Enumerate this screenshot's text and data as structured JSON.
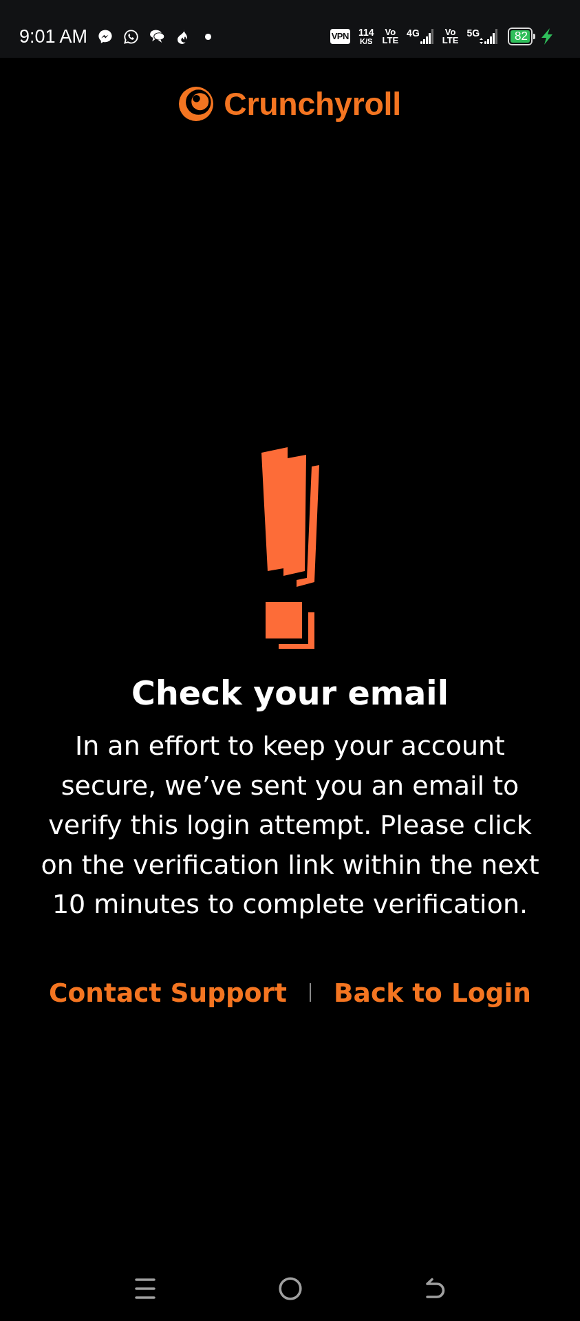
{
  "status_bar": {
    "time": "9:01 AM",
    "indicators": [
      {
        "kind": "vpn",
        "label": "VPN"
      },
      {
        "kind": "speed",
        "value": "114",
        "unit": "K/S"
      },
      {
        "kind": "volte",
        "top": "Vo",
        "bottom": "LTE"
      },
      {
        "kind": "signal",
        "network": "4G",
        "data_activity": false
      },
      {
        "kind": "volte",
        "top": "Vo",
        "bottom": "LTE"
      },
      {
        "kind": "signal",
        "network": "5G",
        "data_activity": true
      }
    ],
    "battery": {
      "percentage": "82",
      "charging": true
    }
  },
  "header": {
    "logo_text": "Crunchyroll"
  },
  "message": {
    "title": "Check your email",
    "body": "In an effort to keep your account secure, we’ve sent you an email to verify this login attempt. Please click on the verification link within the next 10 minutes to complete verification."
  },
  "links": [
    {
      "label": "Contact Support"
    },
    {
      "label": "Back to Login"
    }
  ]
}
